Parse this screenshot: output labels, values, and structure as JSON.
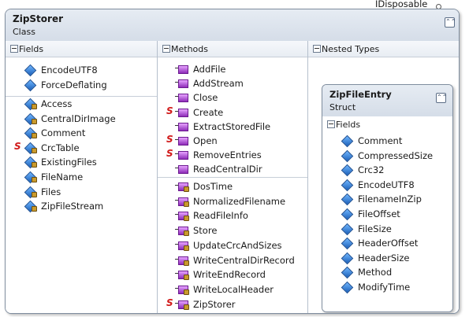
{
  "interface": "IDisposable",
  "class": {
    "name": "ZipStorer",
    "kind": "Class",
    "fields": {
      "label": "Fields",
      "public": [
        {
          "name": "EncodeUTF8",
          "static": false
        },
        {
          "name": "ForceDeflating",
          "static": false
        }
      ],
      "private": [
        {
          "name": "Access",
          "static": false
        },
        {
          "name": "CentralDirImage",
          "static": false
        },
        {
          "name": "Comment",
          "static": false
        },
        {
          "name": "CrcTable",
          "static": true
        },
        {
          "name": "ExistingFiles",
          "static": false
        },
        {
          "name": "FileName",
          "static": false
        },
        {
          "name": "Files",
          "static": false
        },
        {
          "name": "ZipFileStream",
          "static": false
        }
      ]
    },
    "methods": {
      "label": "Methods",
      "public": [
        {
          "name": "AddFile",
          "static": false
        },
        {
          "name": "AddStream",
          "static": false
        },
        {
          "name": "Close",
          "static": false
        },
        {
          "name": "Create",
          "static": true
        },
        {
          "name": "ExtractStoredFile",
          "static": false
        },
        {
          "name": "Open",
          "static": true
        },
        {
          "name": "RemoveEntries",
          "static": true
        },
        {
          "name": "ReadCentralDir",
          "static": false
        }
      ],
      "private": [
        {
          "name": "DosTime",
          "static": false
        },
        {
          "name": "NormalizedFilename",
          "static": false
        },
        {
          "name": "ReadFileInfo",
          "static": false
        },
        {
          "name": "Store",
          "static": false
        },
        {
          "name": "UpdateCrcAndSizes",
          "static": false
        },
        {
          "name": "WriteCentralDirRecord",
          "static": false
        },
        {
          "name": "WriteEndRecord",
          "static": false
        },
        {
          "name": "WriteLocalHeader",
          "static": false
        },
        {
          "name": "ZipStorer",
          "static": true
        }
      ]
    },
    "nested": {
      "label": "Nested Types",
      "type": {
        "name": "ZipFileEntry",
        "kind": "Struct",
        "fields_label": "Fields",
        "fields": [
          "Comment",
          "CompressedSize",
          "Crc32",
          "EncodeUTF8",
          "FilenameInZip",
          "FileOffset",
          "FileSize",
          "HeaderOffset",
          "HeaderSize",
          "Method",
          "ModifyTime"
        ]
      }
    }
  },
  "static_marker": "S",
  "collapse_glyph": "⌃⌃",
  "colors": {
    "header": "#dbe3ec",
    "border": "#7f8d9e",
    "static": "#d11a1a"
  }
}
